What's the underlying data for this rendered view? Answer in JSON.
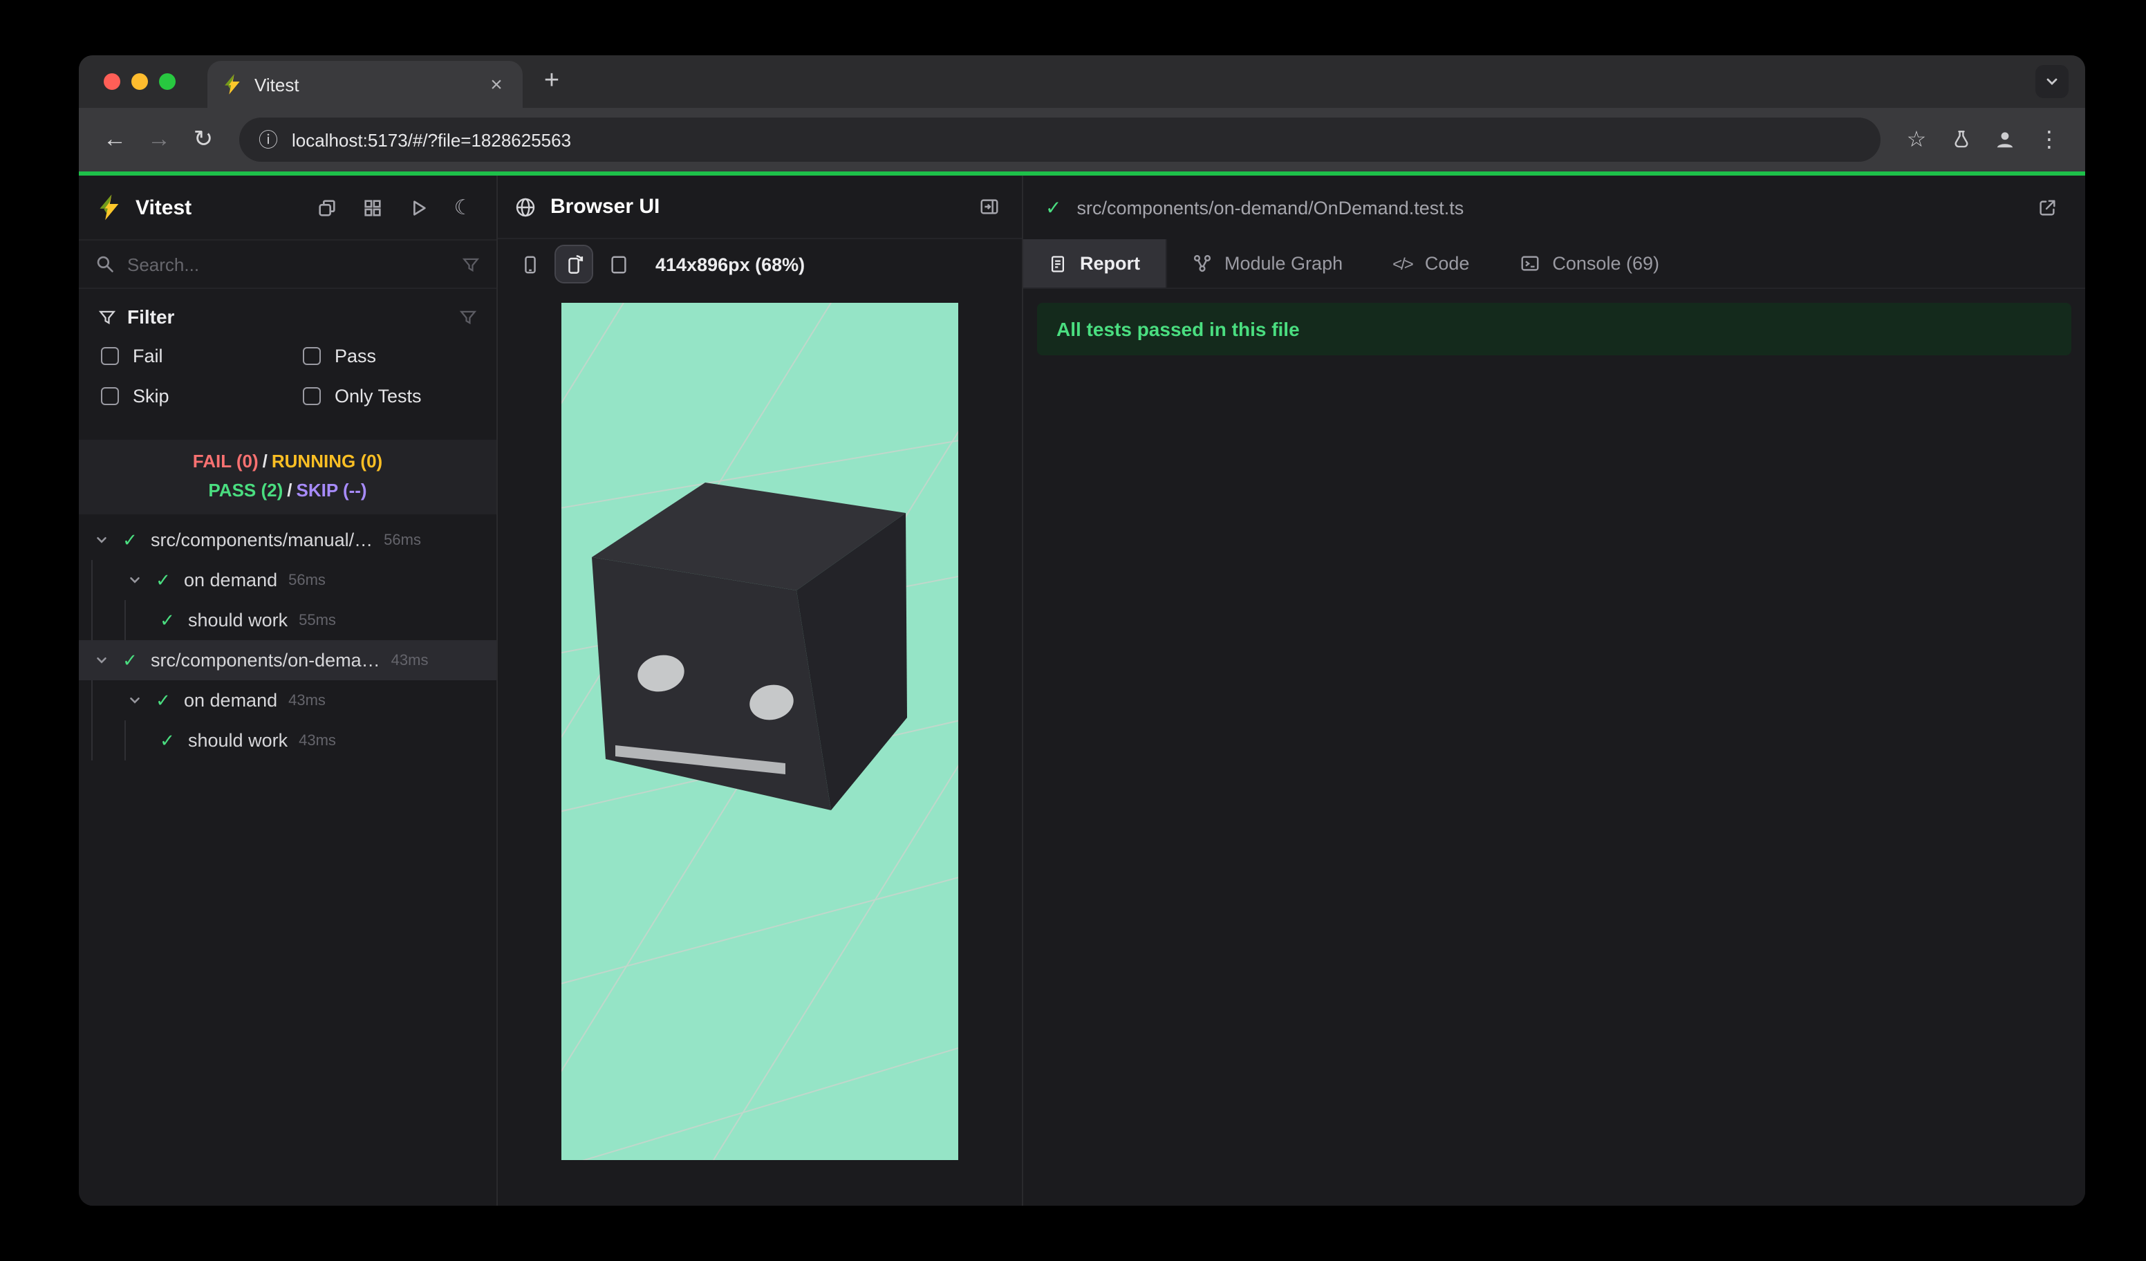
{
  "browser": {
    "tab": {
      "title": "Vitest"
    },
    "url": "localhost:5173/#/?file=1828625563"
  },
  "icons": {
    "back": "←",
    "forward": "→",
    "reload": "↻",
    "star": "☆",
    "menu": "⋮",
    "info": "ⓘ",
    "close_tab": "×",
    "new_tab": "+",
    "check": "✓",
    "moon": "☾",
    "code": "</>"
  },
  "colors": {
    "accent_green": "#4ade80",
    "fail_red": "#f87171",
    "running_yellow": "#fbbf24",
    "skip_purple": "#a78bfa",
    "preview_background": "#95e4c6",
    "progress_line": "#1ec04a"
  },
  "sidebar": {
    "app_name": "Vitest",
    "search_placeholder": "Search...",
    "filter": {
      "title": "Filter",
      "options": [
        "Fail",
        "Pass",
        "Skip",
        "Only Tests"
      ]
    },
    "summary": {
      "fail": "FAIL (0)",
      "running": "RUNNING (0)",
      "pass": "PASS (2)",
      "skip": "SKIP (--)",
      "sep": "/"
    },
    "tree": [
      {
        "label": "src/components/manual/…",
        "time": "56ms",
        "level": 0,
        "status": "pass"
      },
      {
        "label": "on demand",
        "time": "56ms",
        "level": 1,
        "status": "pass"
      },
      {
        "label": "should work",
        "time": "55ms",
        "level": 2,
        "status": "pass"
      },
      {
        "label": "src/components/on-dema…",
        "time": "43ms",
        "level": 0,
        "status": "pass",
        "selected": true
      },
      {
        "label": "on demand",
        "time": "43ms",
        "level": 1,
        "status": "pass"
      },
      {
        "label": "should work",
        "time": "43ms",
        "level": 2,
        "status": "pass"
      }
    ]
  },
  "browser_panel": {
    "title": "Browser UI",
    "viewport_label": "414x896px (68%)"
  },
  "report_panel": {
    "file_path": "src/components/on-demand/OnDemand.test.ts",
    "tabs": [
      {
        "label": "Report",
        "active": true
      },
      {
        "label": "Module Graph",
        "active": false
      },
      {
        "label": "Code",
        "active": false
      },
      {
        "label": "Console (69)",
        "active": false
      }
    ],
    "banner": "All tests passed in this file"
  }
}
